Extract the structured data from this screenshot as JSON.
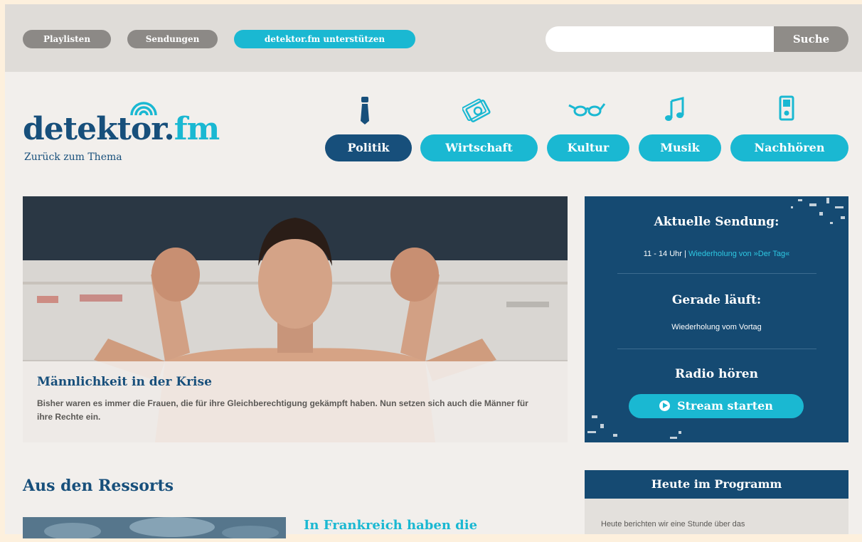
{
  "topbar": {
    "links": [
      "Playlisten",
      "Sendungen"
    ],
    "support_label": "detektor.fm unterstützen",
    "search_placeholder": "",
    "search_button": "Suche"
  },
  "logo": {
    "name_main": "detekt",
    "name_o": "o",
    "name_r": "r.",
    "name_fm": "fm",
    "tagline": "Zurück zum Thema"
  },
  "nav": [
    {
      "label": "Politik",
      "icon": "tie-icon",
      "active": true
    },
    {
      "label": "Wirtschaft",
      "icon": "money-icon",
      "active": false
    },
    {
      "label": "Kultur",
      "icon": "glasses-icon",
      "active": false
    },
    {
      "label": "Musik",
      "icon": "music-note-icon",
      "active": false
    },
    {
      "label": "Nachhören",
      "icon": "ipod-icon",
      "active": false
    }
  ],
  "hero": {
    "title": "Männlichkeit in der Krise",
    "text": "Bisher waren es immer die Frauen, die für ihre Gleichberechtigung gekämpft haben. Nun setzen sich auch die Männer für ihre Rechte ein."
  },
  "now_panel": {
    "current_heading": "Aktuelle Sendung:",
    "current_time": "11 - 14 Uhr",
    "current_separator": " | ",
    "current_show": "Wiederholung von »Der Tag«",
    "playing_heading": "Gerade läuft:",
    "playing_text": "Wiederholung vom Vortag",
    "radio_heading": "Radio hören",
    "stream_button": "Stream starten"
  },
  "ressorts": {
    "title": "Aus den Ressorts",
    "article_headline": "In Frankreich haben die"
  },
  "program": {
    "title": "Heute im Programm",
    "text": "Heute berichten wir eine Stunde über das"
  },
  "colors": {
    "navy": "#174f7b",
    "teal": "#1ab8d2",
    "gray": "#8c8986"
  }
}
